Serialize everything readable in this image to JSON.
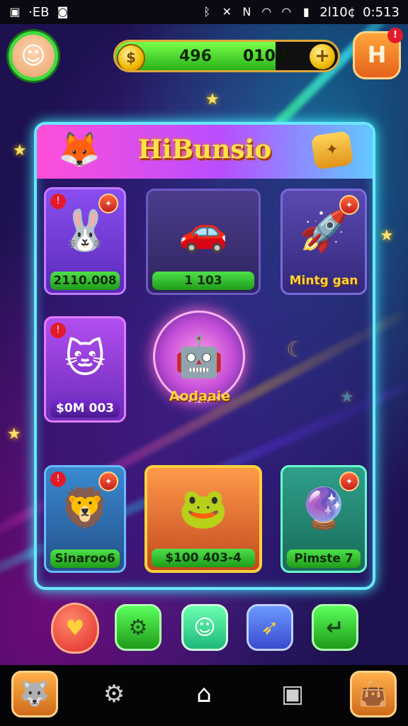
{
  "status_bar": {
    "left_text": "·EB",
    "right_text": "2l10¢",
    "time": "0:513"
  },
  "hud": {
    "coin_value": "496",
    "bar_value": "0100",
    "bar_fill_fraction": 0.72,
    "plus_label": "+",
    "menu_label": "H",
    "menu_badge": "!"
  },
  "panel": {
    "title": "HiBunsio"
  },
  "cards": [
    {
      "price": "2110.008"
    },
    {
      "price": "1  103"
    },
    {
      "price": "Mintg gan"
    },
    {
      "price": "$0M 003"
    },
    {
      "price": "Sinaroo6"
    },
    {
      "price": "$100   403-4"
    },
    {
      "price": "Pimste 7"
    }
  ],
  "featured": {
    "label": "Aodaaie"
  },
  "icons": {
    "avatar": "avatar-face",
    "panel_mascot": "fox-mascot",
    "panel_badge": "gold-badge",
    "bottom_actions": [
      "heart-icon",
      "tool-icon",
      "character-icon",
      "rocket-icon",
      "share-icon"
    ],
    "nav": [
      "cat-profile-icon",
      "gear-icon",
      "home-icon",
      "robot-icon",
      "bag-icon"
    ]
  },
  "colors": {
    "accent": "#3cf5ff",
    "progress_green": "#27b21a",
    "title_gold": "#ffe24a"
  }
}
